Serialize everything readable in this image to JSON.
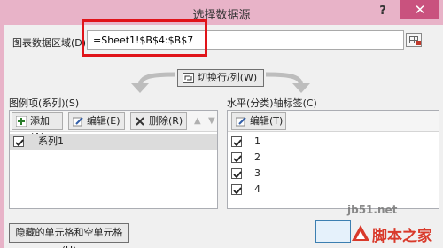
{
  "window": {
    "title": "选择数据源",
    "help_label": "?",
    "close_label": "✕"
  },
  "data_range": {
    "label": "图表数据区域(D):",
    "value": "=Sheet1!$B$4:$B$7"
  },
  "switch_button": {
    "label": "切换行/列(W)"
  },
  "legend": {
    "header": "图例项(系列)(S)",
    "add_label": "添加(A)",
    "edit_label": "编辑(E)",
    "delete_label": "删除(R)",
    "up_label": "▲",
    "down_label": "▼",
    "series": [
      {
        "name": "系列1",
        "checked": true,
        "selected": true
      }
    ]
  },
  "axis": {
    "header": "水平(分类)轴标签(C)",
    "edit_label": "编辑(T)",
    "items": [
      {
        "label": "1",
        "checked": true
      },
      {
        "label": "2",
        "checked": true
      },
      {
        "label": "3",
        "checked": true
      },
      {
        "label": "4",
        "checked": true
      }
    ]
  },
  "footer": {
    "hidden_cells_label": "隐藏的单元格和空单元格(H)"
  },
  "watermark": {
    "url": "jb51.net",
    "brand": "脚本之家"
  },
  "colors": {
    "titlebar": "#e8b3c8",
    "close": "#c9527e",
    "highlight": "#e0141a",
    "brand": "#d93a2b"
  }
}
